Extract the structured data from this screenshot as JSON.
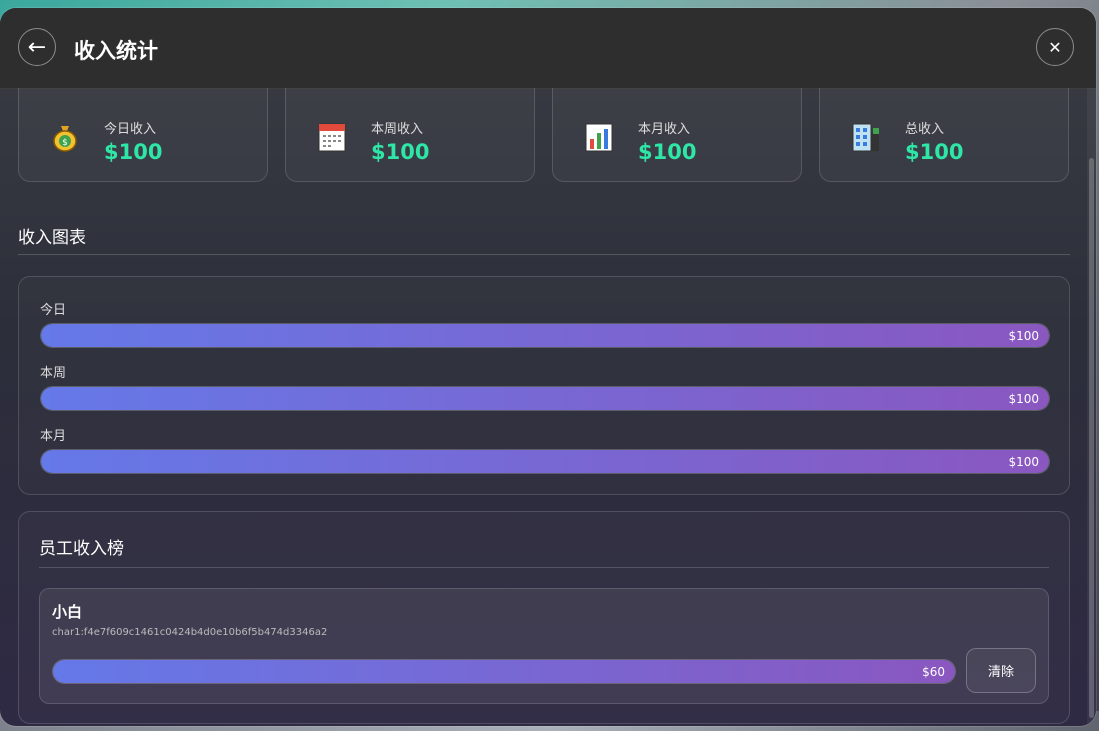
{
  "header": {
    "title": "收入统计",
    "back_icon": "←",
    "close_icon": "✕"
  },
  "stats": [
    {
      "label": "今日收入",
      "value": "$100",
      "icon": "money-bag-icon"
    },
    {
      "label": "本周收入",
      "value": "$100",
      "icon": "calendar-icon"
    },
    {
      "label": "本月收入",
      "value": "$100",
      "icon": "bar-chart-icon"
    },
    {
      "label": "总收入",
      "value": "$100",
      "icon": "building-icon"
    }
  ],
  "colors": {
    "accent": "#2ee6a6",
    "bar_start": "#6579e8",
    "bar_end": "#8a57c0"
  },
  "chart_section": {
    "title": "收入图表",
    "bars": [
      {
        "label": "今日",
        "value": "$100",
        "fill": 1.0
      },
      {
        "label": "本周",
        "value": "$100",
        "fill": 1.0
      },
      {
        "label": "本月",
        "value": "$100",
        "fill": 1.0
      }
    ]
  },
  "employees": {
    "title": "员工收入榜",
    "items": [
      {
        "name": "小白",
        "id": "char1:f4e7f609c1461c0424b4d0e10b6f5b474d3346a2",
        "value": "$60",
        "fill": 1.0,
        "clear_label": "清除"
      }
    ]
  }
}
